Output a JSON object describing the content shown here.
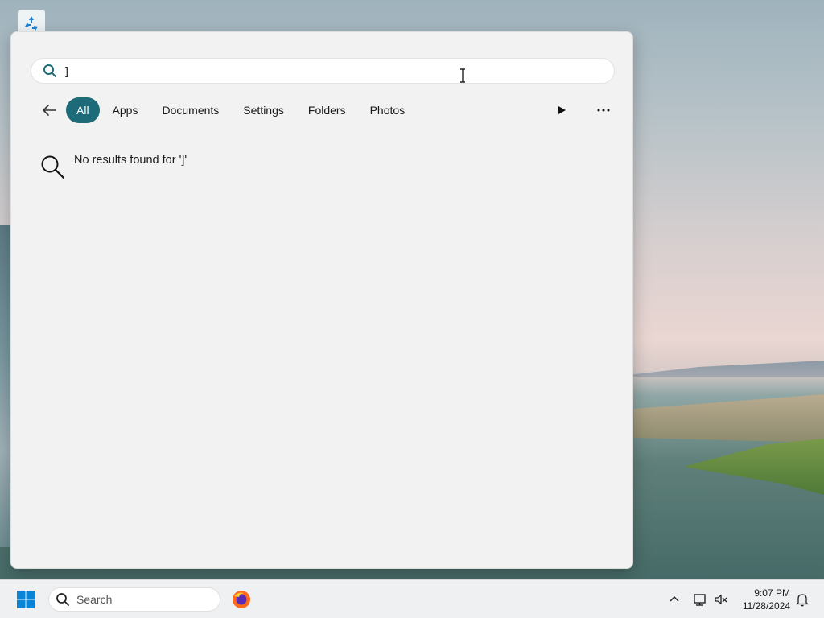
{
  "search_panel": {
    "query": "]",
    "filters": [
      {
        "label": "All",
        "active": true
      },
      {
        "label": "Apps",
        "active": false
      },
      {
        "label": "Documents",
        "active": false
      },
      {
        "label": "Settings",
        "active": false
      },
      {
        "label": "Folders",
        "active": false
      },
      {
        "label": "Photos",
        "active": false
      }
    ],
    "no_results_message": "No results found for ']'"
  },
  "taskbar": {
    "search_placeholder": "Search",
    "clock_time": "9:07 PM",
    "clock_date": "11/28/2024"
  },
  "colors": {
    "accent": "#1d6b78",
    "panel_bg": "#f2f2f2",
    "taskbar_bg": "#eef0f2"
  },
  "icons": [
    "recycle-bin-icon",
    "search-icon",
    "back-arrow-icon",
    "play-icon",
    "more-icon",
    "windows-logo-icon",
    "firefox-icon",
    "chevron-up-icon",
    "network-icon",
    "volume-muted-icon",
    "notification-bell-icon"
  ]
}
